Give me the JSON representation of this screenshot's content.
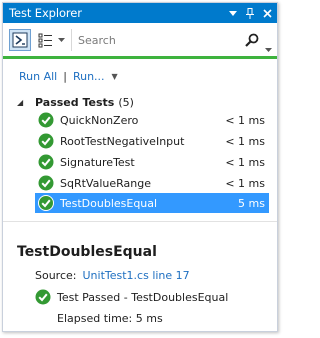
{
  "window": {
    "title": "Test Explorer",
    "title_bar_color": "#007acc"
  },
  "toolbar": {
    "search_placeholder": "Search",
    "icons": [
      "group-by-icon",
      "playlist-icon",
      "search-icon"
    ]
  },
  "status": {
    "color": "#3eb33e"
  },
  "run_links": {
    "run_all": "Run All",
    "separator": "|",
    "run": "Run..."
  },
  "group": {
    "label": "Passed Tests",
    "count": "(5)"
  },
  "tests": [
    {
      "name": "QuickNonZero",
      "duration": "< 1 ms",
      "selected": false
    },
    {
      "name": "RootTestNegativeInput",
      "duration": "< 1 ms",
      "selected": false
    },
    {
      "name": "SignatureTest",
      "duration": "< 1 ms",
      "selected": false
    },
    {
      "name": "SqRtValueRange",
      "duration": "< 1 ms",
      "selected": false
    },
    {
      "name": "TestDoublesEqual",
      "duration": "5 ms",
      "selected": true
    }
  ],
  "details": {
    "title": "TestDoublesEqual",
    "source_label": "Source:",
    "source_link": "UnitTest1.cs line 17",
    "result": "Test Passed - TestDoublesEqual",
    "elapsed": "Elapsed time: 5 ms"
  },
  "colors": {
    "accent": "#007acc",
    "link": "#1e6fc1",
    "selection": "#3399ff",
    "pass": "#339933"
  }
}
